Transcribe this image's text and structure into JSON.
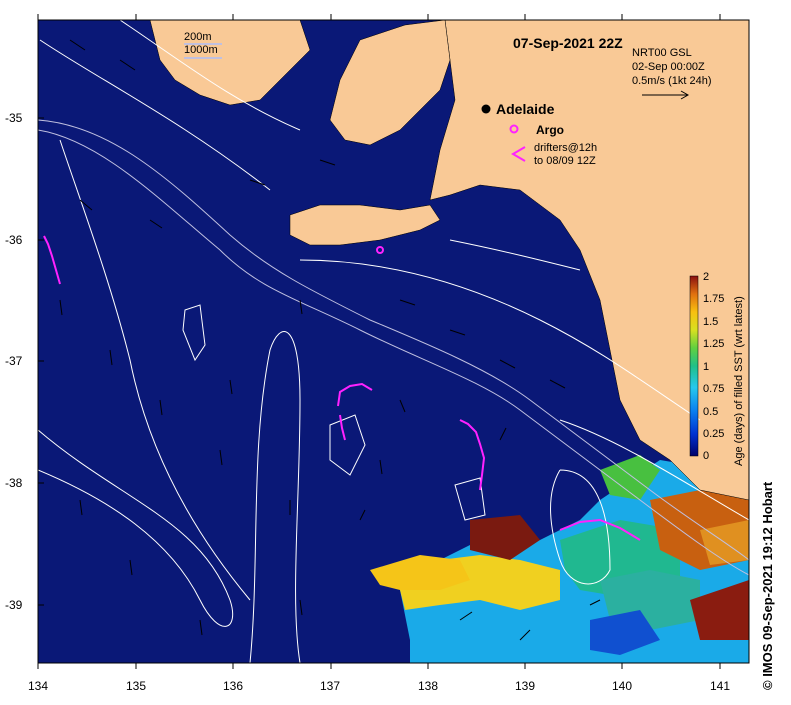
{
  "title": "07-Sep-2021 22Z",
  "scale_bar": {
    "labels": [
      "200m",
      "1000m"
    ]
  },
  "info": {
    "lines": [
      "NRT00 GSL",
      "02-Sep 00:00Z",
      "0.5m/s (1kt 24h)"
    ]
  },
  "legend": {
    "city": "Adelaide",
    "argo": "Argo",
    "drifters_line1": "drifters@12h",
    "drifters_line2": "to 08/09 12Z"
  },
  "colorbar": {
    "title": "Age (days) of filled SST (wrt latest)",
    "ticks": [
      "0",
      "0.25",
      "0.5",
      "0.75",
      "1",
      "1.25",
      "1.5",
      "1.75",
      "2"
    ]
  },
  "axes": {
    "lat_ticks": [
      "-35",
      "-36",
      "-37",
      "-38",
      "-39"
    ],
    "lon_ticks": [
      "134",
      "135",
      "136",
      "137",
      "138",
      "139",
      "140",
      "141"
    ]
  },
  "credit": "© IMOS 09-Sep-2021 19:12 Hobart",
  "colors": {
    "ocean": "#0a1877",
    "land": "#f9c996",
    "drifter": "#ff22ff",
    "contour": "#ffffff",
    "bathymetry": "#c0c0e0"
  }
}
